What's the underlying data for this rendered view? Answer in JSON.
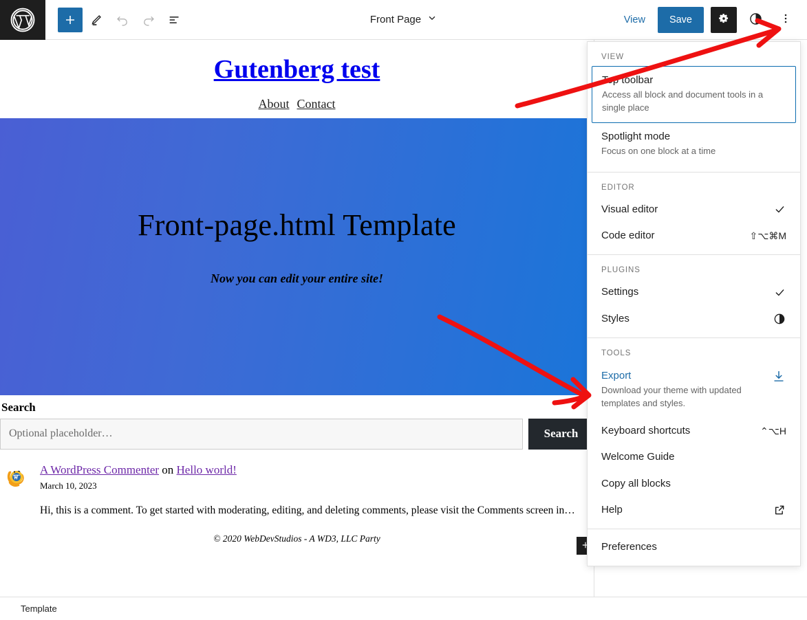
{
  "topbar": {
    "logo_icon": "wordpress-logo-icon",
    "add_block_icon": "plus-icon",
    "tools_icon": "pencil-icon",
    "undo_icon": "undo-arrow-icon",
    "redo_icon": "redo-arrow-icon",
    "list_view_icon": "list-view-icon",
    "document_title": "Front Page",
    "document_chevron_icon": "chevron-down-icon",
    "view_label": "View",
    "save_label": "Save",
    "settings_icon": "gear-icon",
    "styles_icon": "styles-half-circle-icon",
    "options_icon": "three-dots-vertical-icon"
  },
  "canvas": {
    "site_title": "Gutenberg test",
    "nav": [
      {
        "label": "About"
      },
      {
        "label": "Contact"
      }
    ],
    "hero_title": "Front-page.html Template",
    "hero_subtitle": "Now you can edit your entire site!",
    "search": {
      "label": "Search",
      "placeholder": "Optional placeholder…",
      "value": "",
      "button_label": "Search"
    },
    "comment": {
      "avatar_icon": "wordpress-mascot-avatar",
      "author": "A WordPress Commenter",
      "connector": "on",
      "post": "Hello world!",
      "date": "March 10, 2023",
      "text": "Hi, this is a comment. To get started with moderating, editing, and deleting comments, please visit the Comments screen in…"
    },
    "footer": "© 2020 WebDevStudios - A WD3, LLC Party",
    "inserter_icon": "plus-icon"
  },
  "bottombar": {
    "breadcrumb": "Template"
  },
  "menu": {
    "groups": [
      {
        "heading": "View",
        "items": [
          {
            "label": "Top toolbar",
            "desc": "Access all block and document tools in a single place",
            "right": "",
            "right_icon": "",
            "selected": true,
            "blue": false
          },
          {
            "label": "Spotlight mode",
            "desc": "Focus on one block at a time",
            "right": "",
            "right_icon": "",
            "selected": false,
            "blue": false
          }
        ]
      },
      {
        "heading": "Editor",
        "items": [
          {
            "label": "Visual editor",
            "desc": "",
            "right": "✓",
            "right_icon": "check-icon",
            "selected": false,
            "blue": false
          },
          {
            "label": "Code editor",
            "desc": "",
            "right": "⇧⌥⌘M",
            "right_icon": "",
            "selected": false,
            "blue": false
          }
        ]
      },
      {
        "heading": "Plugins",
        "items": [
          {
            "label": "Settings",
            "desc": "",
            "right": "✓",
            "right_icon": "check-icon",
            "selected": false,
            "blue": false
          },
          {
            "label": "Styles",
            "desc": "",
            "right": "◐",
            "right_icon": "styles-half-circle-icon",
            "selected": false,
            "blue": false
          }
        ]
      },
      {
        "heading": "Tools",
        "items": [
          {
            "label": "Export",
            "desc": "Download your theme with updated templates and styles.",
            "right": "",
            "right_icon": "download-icon",
            "selected": false,
            "blue": true
          },
          {
            "label": "Keyboard shortcuts",
            "desc": "",
            "right": "⌃⌥H",
            "right_icon": "",
            "selected": false,
            "blue": false
          },
          {
            "label": "Welcome Guide",
            "desc": "",
            "right": "",
            "right_icon": "",
            "selected": false,
            "blue": false
          },
          {
            "label": "Copy all blocks",
            "desc": "",
            "right": "",
            "right_icon": "",
            "selected": false,
            "blue": false
          },
          {
            "label": "Help",
            "desc": "",
            "right": "",
            "right_icon": "external-link-icon",
            "selected": false,
            "blue": false
          }
        ]
      },
      {
        "heading": "",
        "items": [
          {
            "label": "Preferences",
            "desc": "",
            "right": "",
            "right_icon": "",
            "selected": false,
            "blue": false
          }
        ]
      }
    ]
  },
  "annotations": {
    "arrow_color": "#ee1111",
    "arrow_1_target": "three-dots-vertical-icon",
    "arrow_2_target": "Export"
  },
  "colors": {
    "accent_blue": "#1d6ca8",
    "link_blue": "#0000ee",
    "dark": "#1e1e1e",
    "hero_gradient_start": "#4a5fd4",
    "hero_gradient_end": "#1a75d9",
    "annotation_red": "#ee1111"
  }
}
